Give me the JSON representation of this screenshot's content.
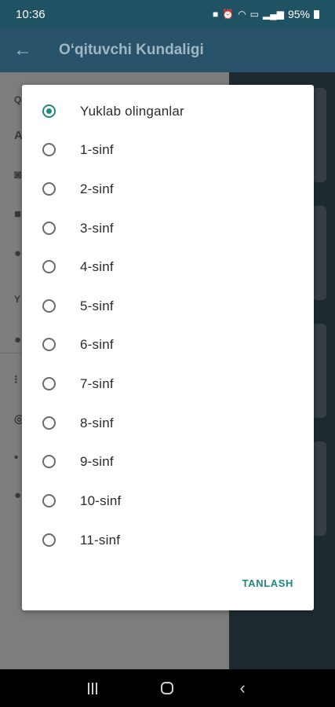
{
  "status_bar": {
    "time": "10:36",
    "battery": "95%",
    "icons": [
      "notification-icon",
      "alarm-icon",
      "wifi-icon",
      "volte-icon",
      "signal-icon",
      "battery-icon"
    ]
  },
  "app_bar": {
    "back_icon": "arrow-back-icon",
    "title": "O‘qituvchi Kundaligi"
  },
  "dialog": {
    "options": [
      {
        "label": "Yuklab olinganlar",
        "checked": true
      },
      {
        "label": "1-sinf",
        "checked": false
      },
      {
        "label": "2-sinf",
        "checked": false
      },
      {
        "label": "3-sinf",
        "checked": false
      },
      {
        "label": "4-sinf",
        "checked": false
      },
      {
        "label": "5-sinf",
        "checked": false
      },
      {
        "label": "6-sinf",
        "checked": false
      },
      {
        "label": "7-sinf",
        "checked": false
      },
      {
        "label": "8-sinf",
        "checked": false
      },
      {
        "label": "9-sinf",
        "checked": false
      },
      {
        "label": "10-sinf",
        "checked": false
      },
      {
        "label": "11-sinf",
        "checked": false
      }
    ],
    "confirm_label": "TANLASH"
  },
  "nav_bar": {
    "icons": [
      "recent-apps-icon",
      "home-icon",
      "back-nav-icon"
    ]
  },
  "colors": {
    "accent": "#1e8a7e",
    "app_bar": "#28536a",
    "status_bar": "#1f5364"
  }
}
